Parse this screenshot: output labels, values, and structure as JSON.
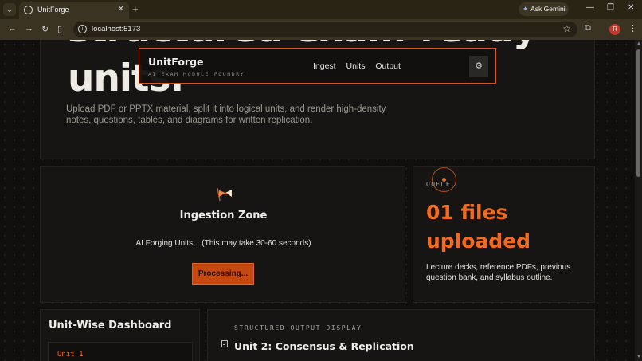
{
  "browser": {
    "tab_title": "UnitForge",
    "url": "localhost:5173",
    "gemini_label": "Ask Gemini",
    "profile_initial": "R"
  },
  "hero": {
    "title_line1": "structured exam-ready",
    "title_line2": "units.",
    "subtitle": "Upload PDF or PPTX material, split it into logical units, and render high-density notes, questions, tables, and diagrams for written replication."
  },
  "nav": {
    "brand": "UnitForge",
    "tagline": "AI EXAM MODULE FOUNDRY",
    "links": [
      "Ingest",
      "Units",
      "Output"
    ],
    "settings_icon": "gear-icon"
  },
  "ingestion": {
    "title": "Ingestion Zone",
    "status": "AI Forging Units... (This may take 30-60 seconds)",
    "button_label": "Processing..."
  },
  "queue": {
    "label": "QUEUE",
    "count_text": "01 files uploaded",
    "description": "Lecture decks, reference PDFs, previous question bank, and syllabus outline."
  },
  "dashboard": {
    "title": "Unit-Wise Dashboard",
    "units": [
      "Unit 1"
    ]
  },
  "output": {
    "label": "STRUCTURED OUTPUT DISPLAY",
    "title": "Unit 2: Consensus & Replication"
  },
  "colors": {
    "accent": "#f26a1b",
    "button": "#c4480f",
    "background": "#100f0e",
    "card": "#161514"
  }
}
